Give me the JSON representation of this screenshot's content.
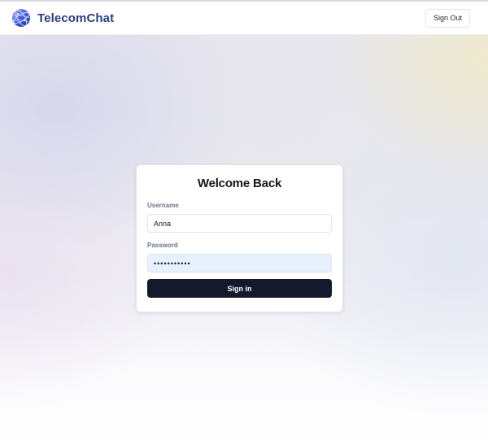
{
  "header": {
    "brand_name": "TelecomChat",
    "logo_icon": "globe-icon",
    "sign_out_label": "Sign Out"
  },
  "login_card": {
    "title": "Welcome Back",
    "username_label": "Username",
    "username_value": "Anna",
    "password_label": "Password",
    "password_value": "•••••••••••",
    "sign_in_label": "Sign in"
  },
  "colors": {
    "brand_text": "#2b3f7e",
    "primary_button": "#141a2b",
    "autofill_field": "#e8f0fe"
  }
}
